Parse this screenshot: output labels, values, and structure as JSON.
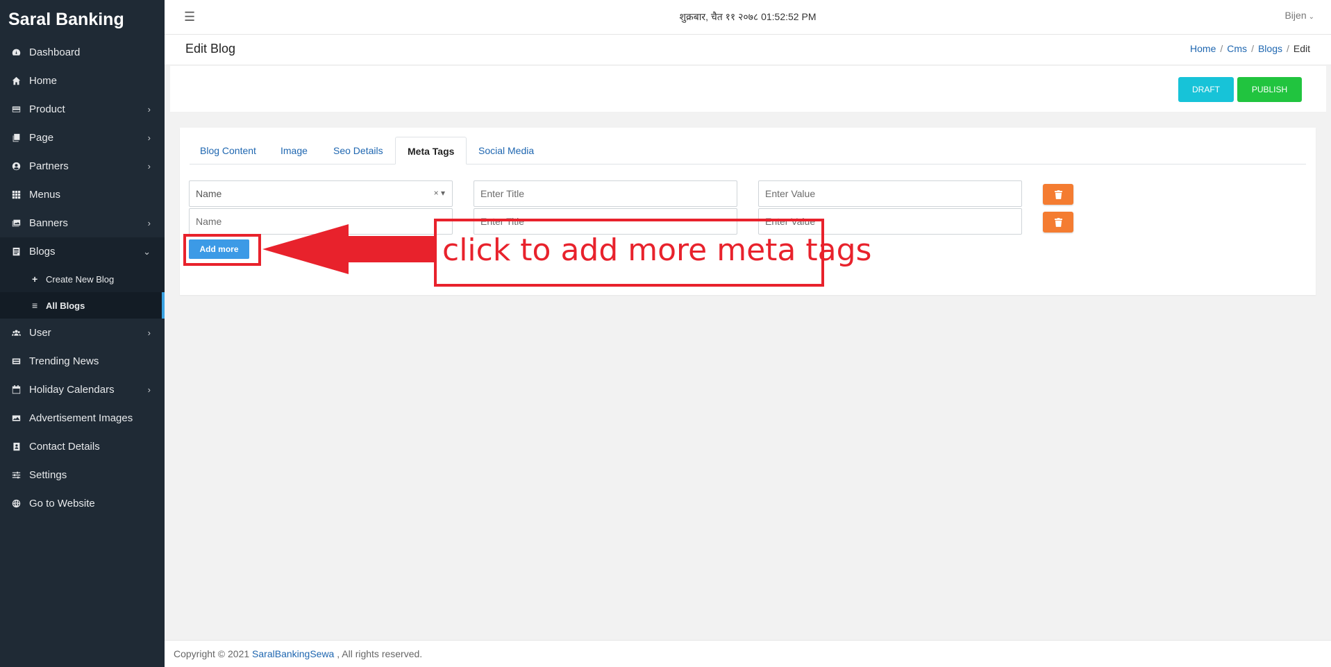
{
  "sidebar": {
    "brand": "Saral Banking",
    "items": [
      {
        "label": "Dashboard",
        "icon": "dashboard-icon",
        "chevron": ""
      },
      {
        "label": "Home",
        "icon": "home-icon",
        "chevron": ""
      },
      {
        "label": "Product",
        "icon": "credit-card-icon",
        "chevron": "›"
      },
      {
        "label": "Page",
        "icon": "pages-icon",
        "chevron": "›"
      },
      {
        "label": "Partners",
        "icon": "user-circle-icon",
        "chevron": "›"
      },
      {
        "label": "Menus",
        "icon": "grid-icon",
        "chevron": ""
      },
      {
        "label": "Banners",
        "icon": "images-icon",
        "chevron": "›"
      },
      {
        "label": "Blogs",
        "icon": "blog-icon",
        "chevron": "⌄"
      },
      {
        "label": "User",
        "icon": "users-icon",
        "chevron": "›"
      },
      {
        "label": "Trending News",
        "icon": "news-icon",
        "chevron": ""
      },
      {
        "label": "Holiday Calendars",
        "icon": "calendar-icon",
        "chevron": "›"
      },
      {
        "label": "Advertisement Images",
        "icon": "image-icon",
        "chevron": ""
      },
      {
        "label": "Contact Details",
        "icon": "address-book-icon",
        "chevron": ""
      },
      {
        "label": "Settings",
        "icon": "sliders-icon",
        "chevron": ""
      },
      {
        "label": "Go to Website",
        "icon": "globe-icon",
        "chevron": ""
      }
    ],
    "blog_sub": [
      {
        "label": "Create New Blog",
        "icon": "plus-icon"
      },
      {
        "label": "All Blogs",
        "icon": "list-icon"
      }
    ]
  },
  "topbar": {
    "menu_icon": "hamburger-icon",
    "datetime": "शुक्रबार, चैत ११ २०७८  01:52:52 PM",
    "user": "Bijen"
  },
  "page": {
    "title": "Edit Blog",
    "breadcrumb": [
      "Home",
      "Cms",
      "Blogs",
      "Edit"
    ]
  },
  "actions": {
    "draft": "DRAFT",
    "publish": "PUBLISH"
  },
  "tabs": [
    "Blog Content",
    "Image",
    "Seo Details",
    "Meta Tags",
    "Social Media"
  ],
  "active_tab": "Meta Tags",
  "meta_rows": [
    {
      "type": "Name",
      "title_placeholder": "Enter Title",
      "value_placeholder": "Enter Value"
    },
    {
      "type": "Name",
      "title_placeholder": "Enter Title",
      "value_placeholder": "Enter Value"
    }
  ],
  "add_more": "Add more",
  "annotation": {
    "text": "click to add more meta tags",
    "color": "#e8222c"
  },
  "footer": {
    "prefix": "Copyright © 2021 ",
    "link": "SaralBankingSewa",
    "suffix": " , All rights reserved."
  },
  "colors": {
    "sidebar": "#1f2a35",
    "draft": "#17c3d8",
    "publish": "#21c43f",
    "delete": "#f47c31",
    "add_more": "#3c9ae6",
    "link": "#1e66b0"
  }
}
